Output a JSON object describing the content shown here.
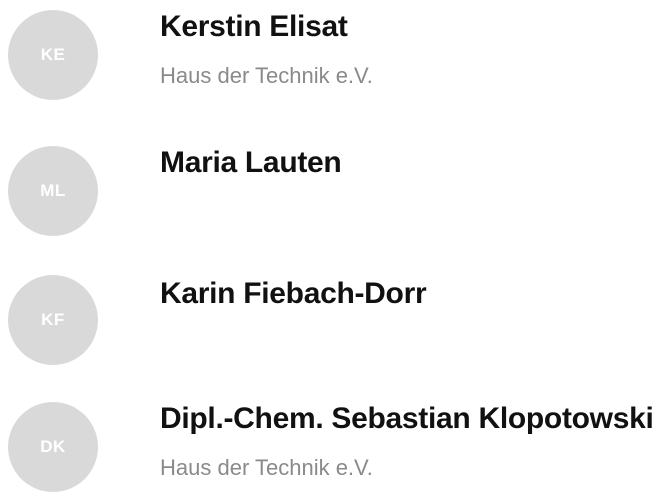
{
  "people": [
    {
      "initials": "KE",
      "name": "Kerstin Elisat",
      "organization": "Haus der Technik e.V."
    },
    {
      "initials": "ML",
      "name": "Maria Lauten",
      "organization": ""
    },
    {
      "initials": "KF",
      "name": "Karin Fiebach-Dorr",
      "organization": ""
    },
    {
      "initials": "DK",
      "name": "Dipl.-Chem. Sebastian Klopotowski",
      "organization": "Haus der Technik e.V."
    }
  ],
  "colors": {
    "avatar_bg": "#d9d9d9",
    "avatar_text": "#ffffff",
    "name_text": "#111111",
    "org_text": "#8a8a8a"
  }
}
